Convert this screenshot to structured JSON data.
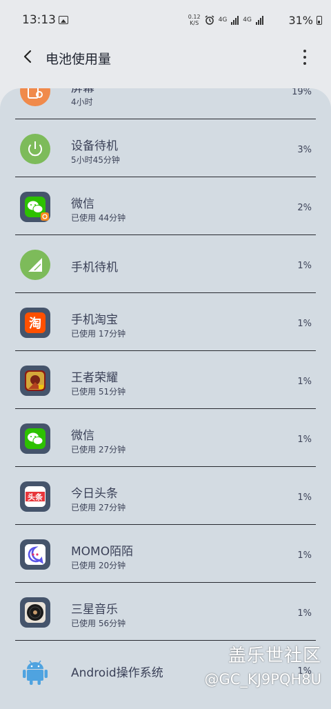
{
  "status_bar": {
    "time": "13:13",
    "net_speed_value": "0.12",
    "net_speed_unit": "K/S",
    "network_label_1": "4G",
    "network_label_2": "4G",
    "battery": "31%"
  },
  "header": {
    "title": "电池使用量"
  },
  "rows": [
    {
      "name": "屏幕",
      "sub": "4小时",
      "percent": "19%",
      "icon": "screen-icon",
      "icon_color": "#f08a4b"
    },
    {
      "name": "设备待机",
      "sub": "5小时45分钟",
      "percent": "3%",
      "icon": "power-icon",
      "icon_color": "#7dbb5a"
    },
    {
      "name": "微信",
      "sub": "已使用 44分钟",
      "percent": "2%",
      "icon": "wechat-icon",
      "icon_color": "#2dc100"
    },
    {
      "name": "手机待机",
      "sub": "",
      "percent": "1%",
      "icon": "signal-icon",
      "icon_color": "#7dbb5a"
    },
    {
      "name": "手机淘宝",
      "sub": "已使用 17分钟",
      "percent": "1%",
      "icon": "taobao-icon",
      "icon_color": "#ff5000"
    },
    {
      "name": "王者荣耀",
      "sub": "已使用 51分钟",
      "percent": "1%",
      "icon": "game-icon",
      "icon_color": "#c0392b"
    },
    {
      "name": "微信",
      "sub": "已使用 27分钟",
      "percent": "1%",
      "icon": "wechat-icon",
      "icon_color": "#2dc100"
    },
    {
      "name": "今日头条",
      "sub": "已使用 27分钟",
      "percent": "1%",
      "icon": "toutiao-icon",
      "icon_color": "#e8363b"
    },
    {
      "name": "MOMO陌陌",
      "sub": "已使用 20分钟",
      "percent": "1%",
      "icon": "momo-icon",
      "icon_color": "#5b55e8"
    },
    {
      "name": "三星音乐",
      "sub": "已使用 56分钟",
      "percent": "1%",
      "icon": "music-icon",
      "icon_color": "#1a1a1a"
    },
    {
      "name": "Android操作系统",
      "sub": "",
      "percent": "1%",
      "icon": "android-icon",
      "icon_color": "#4fa3e0"
    }
  ],
  "watermark": {
    "line1": "盖乐世社区",
    "line2": "@GC_KJ9PQH8U"
  }
}
